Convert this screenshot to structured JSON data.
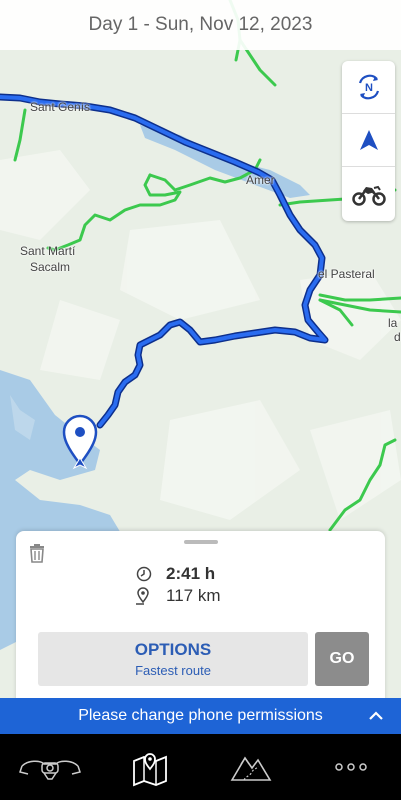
{
  "header": {
    "title": "Day 1 - Sun, Nov 12, 2023"
  },
  "map_labels": {
    "sant_genis": "Sant Genís",
    "amer": "Amer",
    "sant_marti": "Sant Martí",
    "sacalm": "Sacalm",
    "el_pasteral": "el Pasteral",
    "la": "la",
    "d": "d"
  },
  "map_controls": [
    {
      "icon": "north-compass-icon"
    },
    {
      "icon": "navigation-arrow-icon"
    },
    {
      "icon": "motorcycle-icon"
    }
  ],
  "route_card": {
    "duration": "2:41 h",
    "distance": "117 km",
    "options_label": "OPTIONS",
    "options_sub": "Fastest route",
    "go_label": "GO"
  },
  "banner": {
    "text": "Please change phone permissions"
  },
  "bottom_nav": [
    {
      "icon": "motorbike-front-icon"
    },
    {
      "icon": "map-pin-icon",
      "active": true
    },
    {
      "icon": "mountain-icon"
    },
    {
      "icon": "more-icon"
    }
  ],
  "colors": {
    "route": "#1e4fc2",
    "green_roads": "#3cc94e",
    "water": "#a9cbe6",
    "banner": "#1e64d6"
  }
}
